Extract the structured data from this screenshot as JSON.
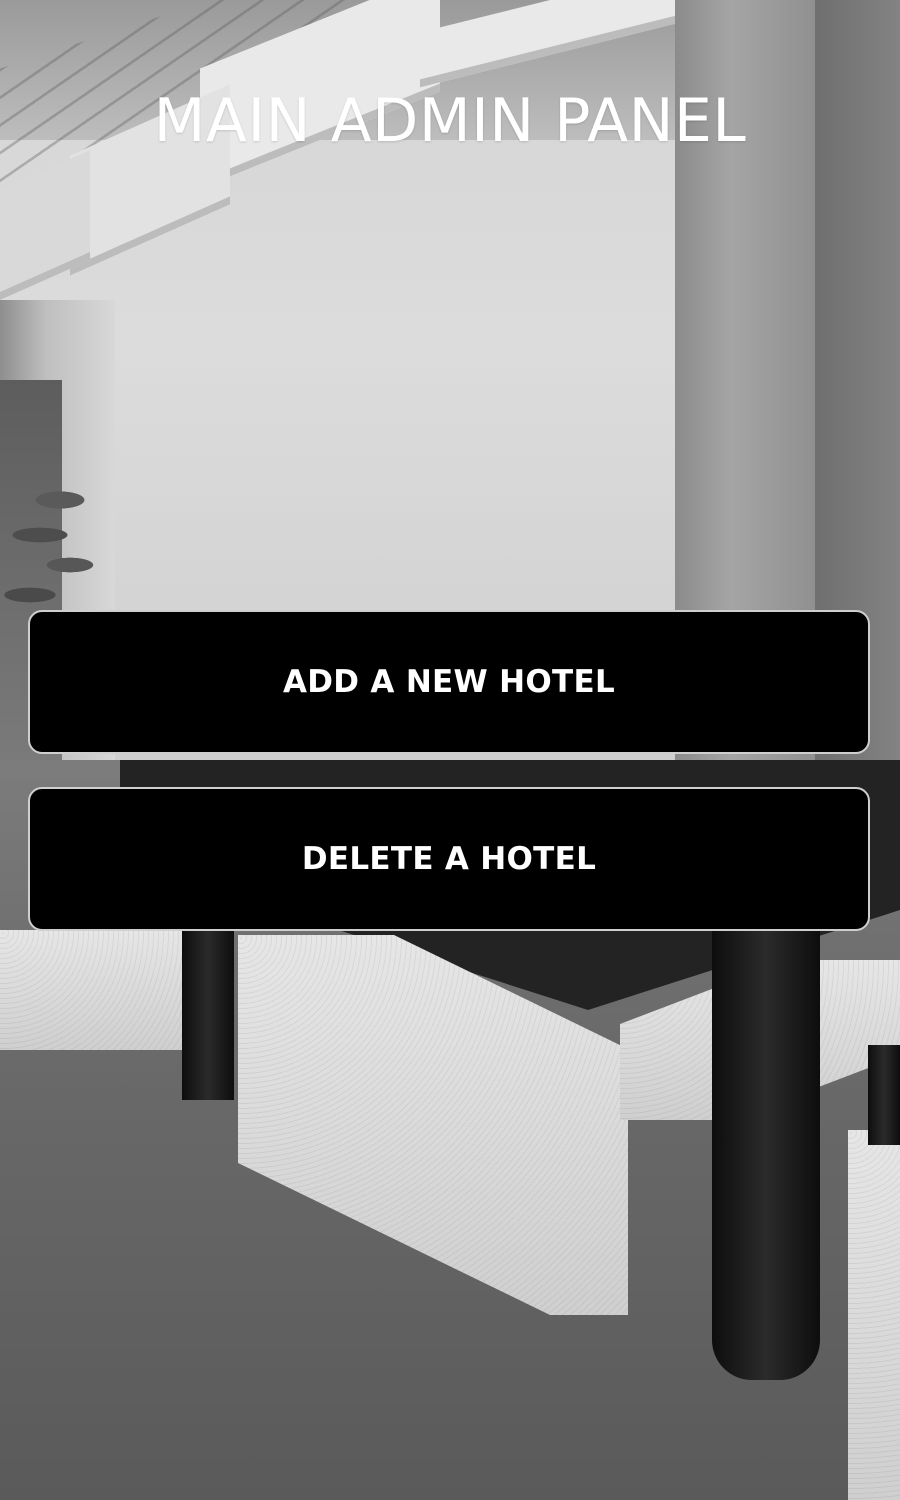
{
  "header": {
    "title": "MAIN ADMIN PANEL"
  },
  "actions": {
    "add_hotel_label": "ADD A NEW HOTEL",
    "delete_hotel_label": "DELETE A HOTEL"
  },
  "colors": {
    "button_background": "#000000",
    "button_border": "#cfcfcf",
    "button_text": "#ffffff",
    "title_text": "#ffffff"
  }
}
